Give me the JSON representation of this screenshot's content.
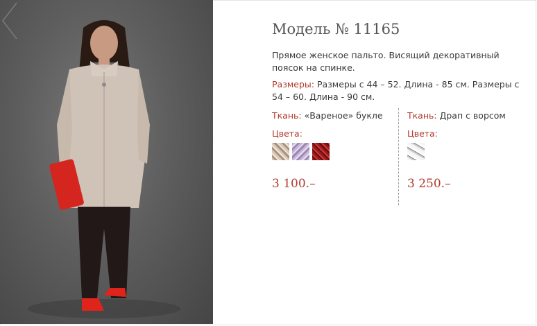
{
  "product": {
    "title": "Модель № 11165",
    "description": "Прямое женское пальто. Висящий декоративный поясок на спинке.",
    "sizes_label": "Размеры:",
    "sizes_text": " Размеры с 44 – 52. Длина - 85 см. Размеры с 54 – 60. Длина - 90 см."
  },
  "variants": [
    {
      "fabric_label": "Ткань:",
      "fabric_value": " «Вареное» букле",
      "colors_label": "Цвета:",
      "price": "3 100.–",
      "swatches": [
        "beige-boucle",
        "lilac-boucle",
        "red-boucle"
      ]
    },
    {
      "fabric_label": "Ткань:",
      "fabric_value": " Драп с ворсом",
      "colors_label": "Цвета:",
      "price": "3 250.–",
      "swatches": [
        "grey-white-pile"
      ]
    }
  ],
  "icons": {
    "gallery_prev": "chevron-left-icon"
  },
  "colors": {
    "accent": "#b13a2c",
    "text": "#3a3a3a",
    "title": "#555555"
  }
}
